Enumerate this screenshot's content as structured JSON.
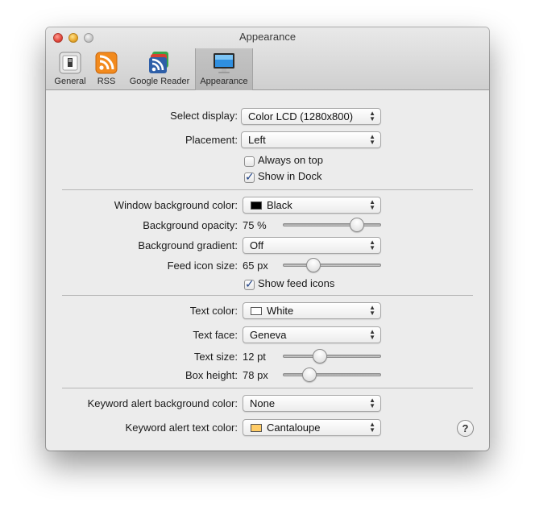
{
  "window": {
    "title": "Appearance"
  },
  "toolbar": {
    "items": [
      {
        "label": "General",
        "icon": "switch-icon"
      },
      {
        "label": "RSS",
        "icon": "rss-icon"
      },
      {
        "label": "Google Reader",
        "icon": "google-reader-icon"
      },
      {
        "label": "Appearance",
        "icon": "display-icon",
        "selected": true
      }
    ]
  },
  "display": {
    "select_display_label": "Select display:",
    "select_display_value": "Color LCD (1280x800)",
    "placement_label": "Placement:",
    "placement_value": "Left",
    "always_on_top_label": "Always on top",
    "always_on_top_checked": false,
    "show_in_dock_label": "Show in Dock",
    "show_in_dock_checked": true
  },
  "window_style": {
    "bg_color_label": "Window background color:",
    "bg_color_value": "Black",
    "bg_color_swatch": "#000000",
    "opacity_label": "Background opacity:",
    "opacity_value": "75 %",
    "opacity_level": 0.8,
    "gradient_label": "Background gradient:",
    "gradient_value": "Off",
    "feed_icon_size_label": "Feed icon size:",
    "feed_icon_size_value": "65 px",
    "feed_icon_size_level": 0.28,
    "show_feed_icons_label": "Show feed icons",
    "show_feed_icons_checked": true
  },
  "text_style": {
    "text_color_label": "Text color:",
    "text_color_value": "White",
    "text_color_swatch": "#ffffff",
    "text_face_label": "Text face:",
    "text_face_value": "Geneva",
    "text_size_label": "Text size:",
    "text_size_value": "12 pt",
    "text_size_level": 0.36,
    "box_height_label": "Box height:",
    "box_height_value": "78 px",
    "box_height_level": 0.23
  },
  "keyword": {
    "bg_color_label": "Keyword alert background color:",
    "bg_color_value": "None",
    "text_color_label": "Keyword alert text color:",
    "text_color_value": "Cantaloupe",
    "text_color_swatch": "#ffcc66"
  },
  "help": {
    "label": "?"
  },
  "colors": {
    "checkbox_mark": "#1b3f86"
  }
}
